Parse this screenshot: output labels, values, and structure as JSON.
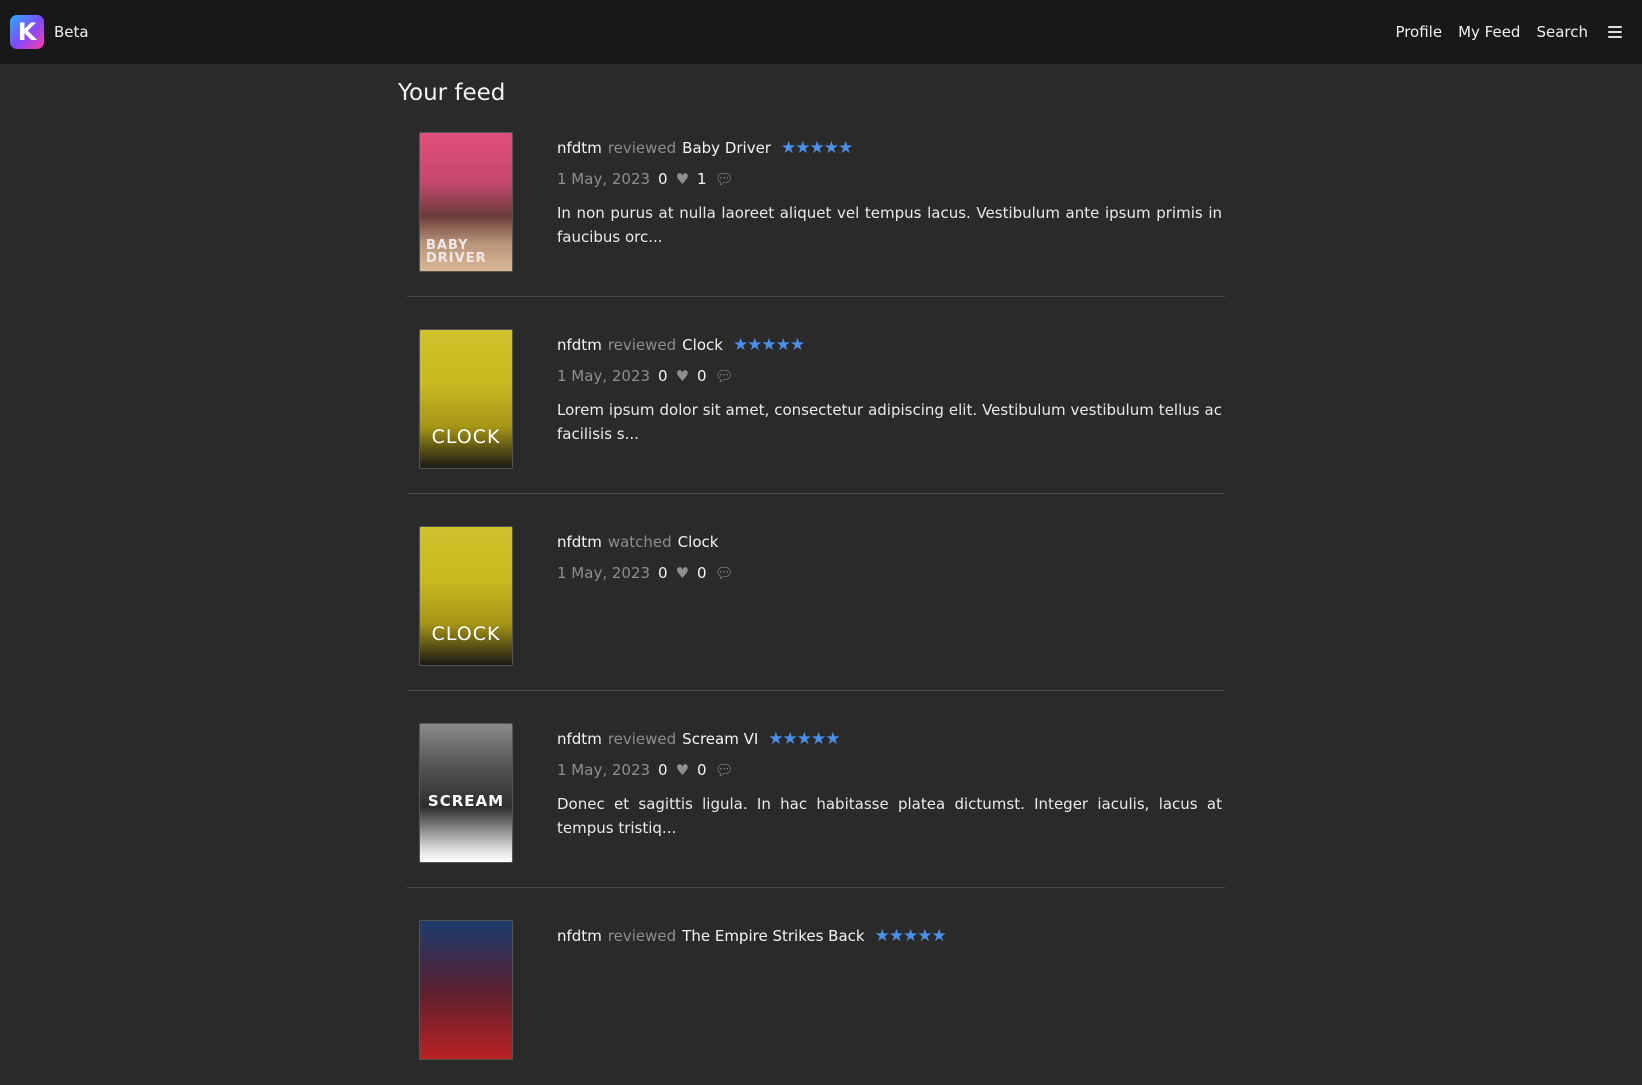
{
  "header": {
    "logo_letter": "K",
    "brand_label": "Beta",
    "nav": [
      "Profile",
      "My Feed",
      "Search"
    ],
    "menu_icon": "hamburger-icon",
    "logo_colors": [
      "#2ab0ff",
      "#7a4dff",
      "#ff3aa8"
    ]
  },
  "page": {
    "title": "Your feed"
  },
  "colors": {
    "star": "#4a8fe8",
    "muted": "#8e8e8e",
    "background": "#2a2a2a"
  },
  "feed": [
    {
      "user": "nfdtm",
      "action": "reviewed",
      "movie": "Baby Driver",
      "rating": 5,
      "stars": "★★★★★",
      "date": "1 May, 2023",
      "likes": "0",
      "comments": "1",
      "excerpt": "In non purus at nulla laoreet aliquet vel tempus lacus. Vestibulum ante ipsum primis in faucibus orc...",
      "poster_text": "BABY DRIVER"
    },
    {
      "user": "nfdtm",
      "action": "reviewed",
      "movie": "Clock",
      "rating": 5,
      "stars": "★★★★★",
      "date": "1 May, 2023",
      "likes": "0",
      "comments": "0",
      "excerpt": "Lorem ipsum dolor sit amet, consectetur adipiscing elit. Vestibulum vestibulum tellus ac facilisis s...",
      "poster_text": "CLOCK"
    },
    {
      "user": "nfdtm",
      "action": "watched",
      "movie": "Clock",
      "date": "1 May, 2023",
      "likes": "0",
      "comments": "0",
      "poster_text": "CLOCK"
    },
    {
      "user": "nfdtm",
      "action": "reviewed",
      "movie": "Scream VI",
      "rating": 5,
      "stars": "★★★★★",
      "date": "1 May, 2023",
      "likes": "0",
      "comments": "0",
      "excerpt": "Donec et sagittis ligula. In hac habitasse platea dictumst. Integer iaculis, lacus at tempus tristiq...",
      "poster_text": "SCREAM"
    },
    {
      "user": "nfdtm",
      "action": "reviewed",
      "movie": "The Empire Strikes Back",
      "rating": 5,
      "stars": "★★★★★"
    }
  ]
}
